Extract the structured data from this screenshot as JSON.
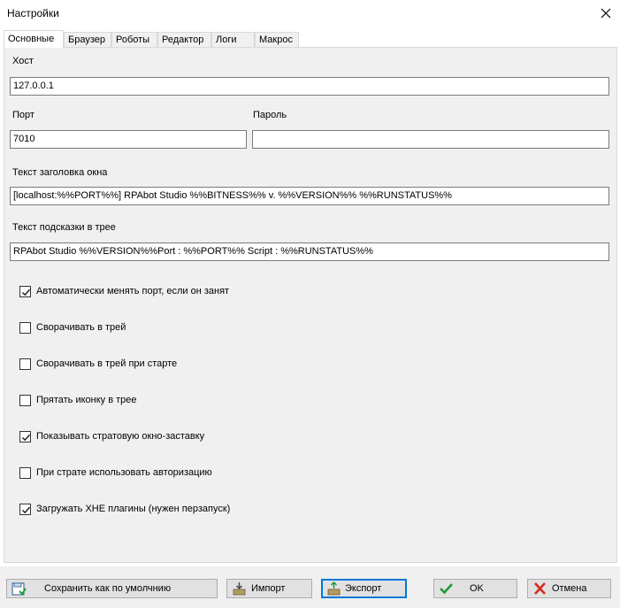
{
  "window": {
    "title": "Настройки"
  },
  "tabs": [
    {
      "label": "Основные"
    },
    {
      "label": "Браузер"
    },
    {
      "label": "Роботы"
    },
    {
      "label": "Редактор"
    },
    {
      "label": "Логи"
    },
    {
      "label": "Макрос"
    }
  ],
  "form": {
    "host_label": "Хост",
    "host_value": "127.0.0.1",
    "port_label": "Порт",
    "port_value": "7010",
    "password_label": "Пароль",
    "password_value": "",
    "window_title_label": "Текст заголовка окна",
    "window_title_value": "[localhost:%%PORT%%] RPAbot Studio %%BITNESS%% v. %%VERSION%% %%RUNSTATUS%%",
    "tray_hint_label": "Текст подсказки в трее",
    "tray_hint_value": "RPAbot Studio %%VERSION%%Port : %%PORT%% Script : %%RUNSTATUS%%"
  },
  "checkboxes": [
    {
      "label": "Автоматически менять порт, если он занят",
      "checked": true
    },
    {
      "label": "Сворачивать в трей",
      "checked": false
    },
    {
      "label": "Сворачивать в трей при старте",
      "checked": false
    },
    {
      "label": "Прятать иконку в трее",
      "checked": false
    },
    {
      "label": "Показывать стратовую окно-заставку",
      "checked": true
    },
    {
      "label": "При страте использовать авторизацию",
      "checked": false
    },
    {
      "label": "Загружать XHE плагины (нужен перзапуск)",
      "checked": true
    }
  ],
  "buttons": {
    "save_default": "Сохранить как по умолчнию",
    "import": "Импорт",
    "export": "Экспорт",
    "ok": "OK",
    "cancel": "Отмена"
  },
  "colors": {
    "ok_check": "#1e9b3a",
    "cancel_x": "#d9281c",
    "focus_border": "#0078d7"
  }
}
